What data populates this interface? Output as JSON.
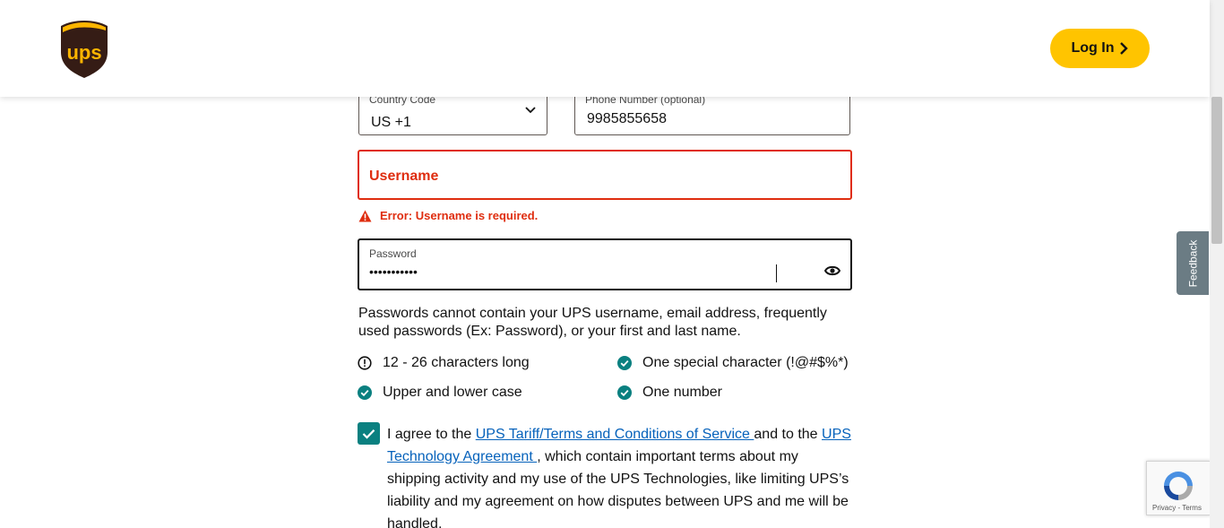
{
  "header": {
    "logo_alt": "ups",
    "login_label": "Log In"
  },
  "form": {
    "country_code": {
      "label": "Country Code",
      "value": "US +1"
    },
    "phone": {
      "label": "Phone Number (optional)",
      "value": "9985855658"
    },
    "username": {
      "label": "Username",
      "error": "Error: Username is required."
    },
    "password": {
      "label": "Password",
      "value": "•••••••••••"
    },
    "hint": "Passwords cannot contain your UPS username, email address, frequently used passwords (Ex: Password), or your first and last name.",
    "requirements": [
      {
        "label": "12 - 26 characters long",
        "status": "pending"
      },
      {
        "label": "One special character (!@#$%*)",
        "status": "met"
      },
      {
        "label": "Upper and lower case",
        "status": "met"
      },
      {
        "label": "One number",
        "status": "met"
      }
    ],
    "agreement": {
      "checked": true,
      "prefix": "I agree to the ",
      "link1": "UPS Tariff/Terms and Conditions of Service ",
      "middle": "and to the ",
      "link2": "UPS Technology Agreement ",
      "suffix": ", which contain important terms about my shipping activity and my use of the UPS Technologies, like limiting UPS’s liability and my agreement on how disputes between UPS and me will be handled."
    }
  },
  "feedback_label": "Feedback",
  "recaptcha": {
    "links": "Privacy - Terms"
  },
  "colors": {
    "brand_brown": "#351c15",
    "brand_gold": "#ffc400",
    "error_red": "#df2d0f",
    "success_teal": "#0a8080",
    "link_blue": "#0662bb"
  }
}
